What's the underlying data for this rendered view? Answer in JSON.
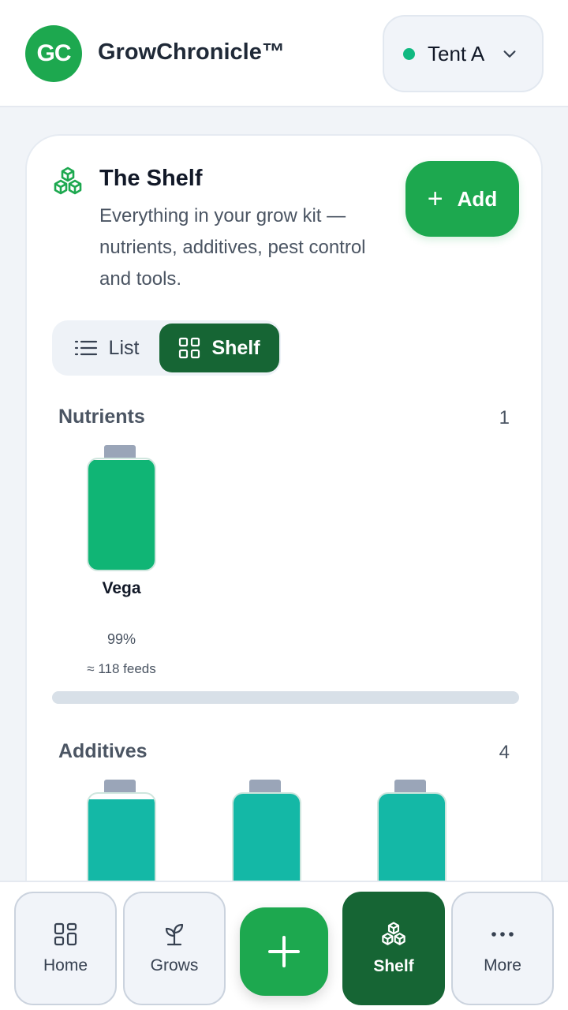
{
  "app": {
    "logo_text": "GC",
    "title": "GrowChronicle™"
  },
  "tent": {
    "label": "Tent A",
    "status_color": "#10b981"
  },
  "shelf": {
    "title": "The Shelf",
    "description": "Everything in your grow kit — nutrients, additives, pest control and tools.",
    "add_label": "Add",
    "add_icon": "plus-icon"
  },
  "view_toggle": {
    "list_label": "List",
    "shelf_label": "Shelf",
    "selected": "Shelf"
  },
  "sections": [
    {
      "title": "Nutrients",
      "count": "1",
      "items": [
        {
          "name": "Vega",
          "percent_label": "99%",
          "feeds_label": "≈ 118 feeds",
          "fill_fraction": 0.99,
          "color": "#10b575"
        }
      ]
    },
    {
      "title": "Additives",
      "count": "4",
      "items": [
        {
          "fill_fraction": 0.95,
          "color": "#14b8a6"
        },
        {
          "fill_fraction": 1.0,
          "color": "#14b8a6"
        },
        {
          "fill_fraction": 1.0,
          "color": "#14b8a6"
        }
      ]
    }
  ],
  "nav": {
    "home_label": "Home",
    "grows_label": "Grows",
    "add_icon": "plus-icon",
    "shelf_label": "Shelf",
    "more_label": "More",
    "active": "Shelf"
  },
  "colors": {
    "primary": "#1da84f",
    "active_dark": "#166534",
    "nutrient": "#10b575",
    "additive": "#14b8a6"
  }
}
